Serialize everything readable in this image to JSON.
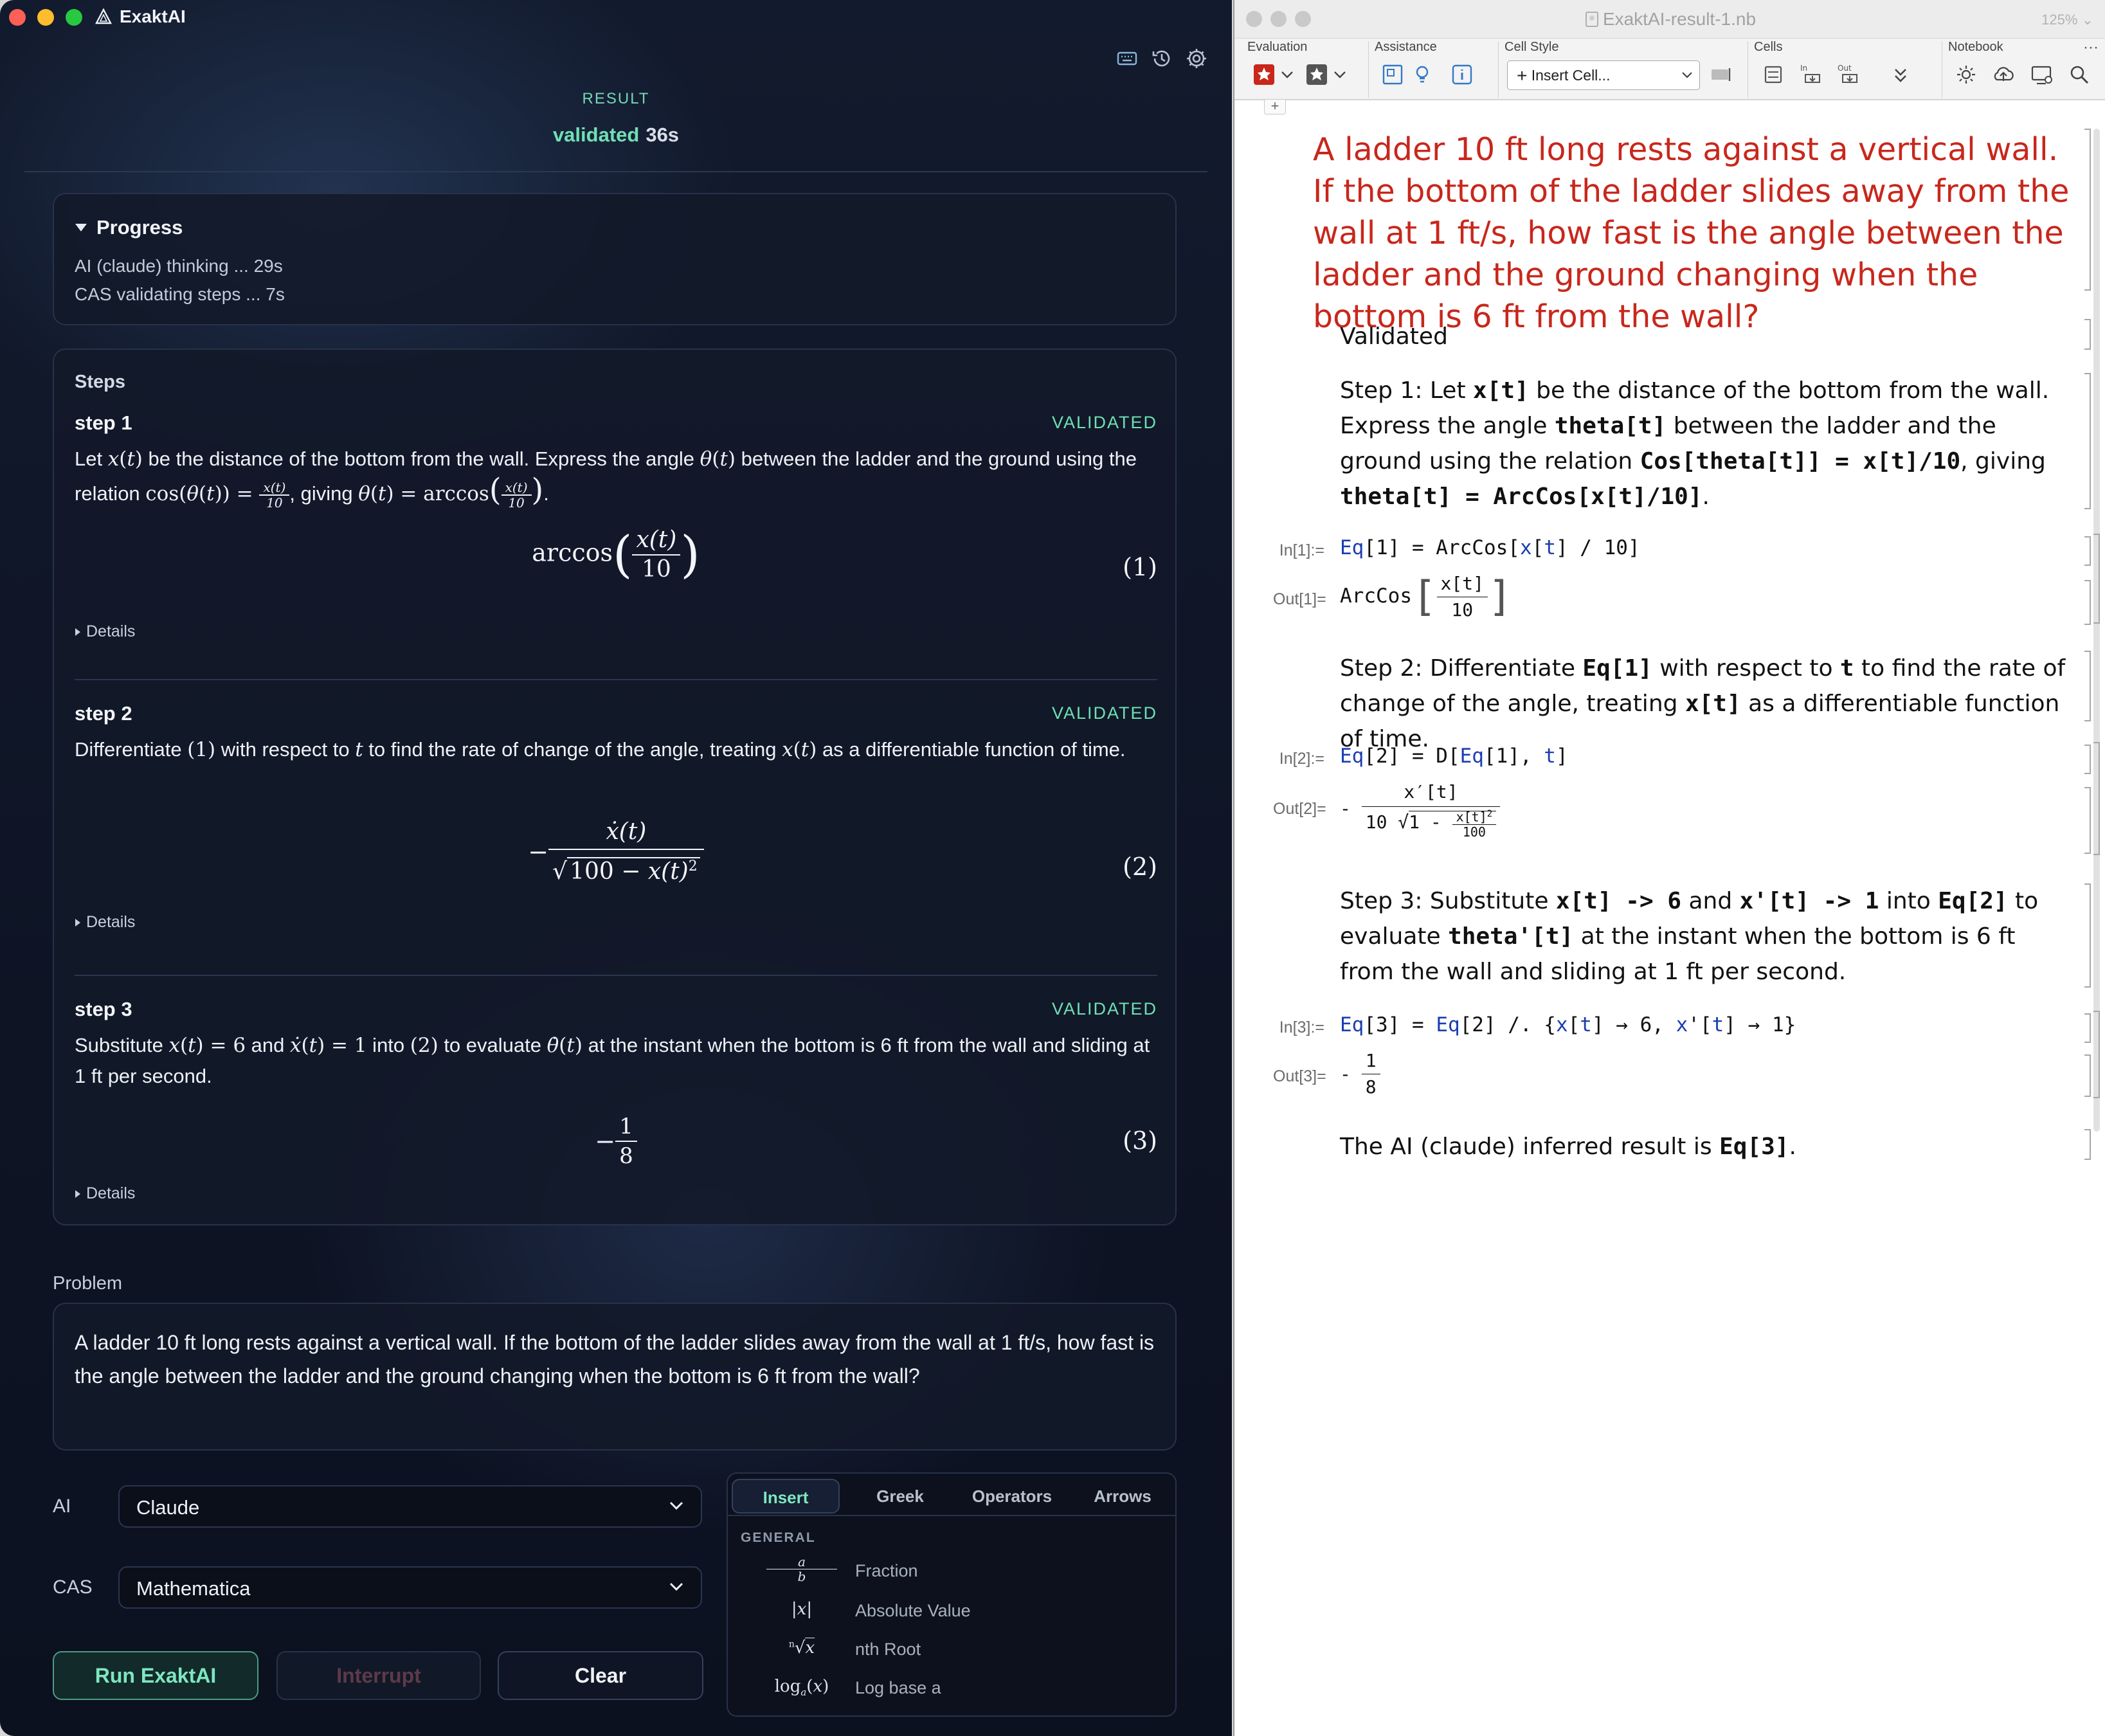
{
  "app": {
    "title": "ExaktAI",
    "result_label": "RESULT",
    "status": "validated",
    "time": "36s"
  },
  "progress": {
    "title": "Progress",
    "lines": [
      "AI (claude) thinking ... 29s",
      "CAS validating steps ... 7s"
    ]
  },
  "steps": {
    "title": "Steps",
    "details_label": "Details",
    "items": [
      {
        "name": "step 1",
        "badge": "VALIDATED",
        "eq_num": "(1)"
      },
      {
        "name": "step 2",
        "badge": "VALIDATED",
        "eq_num": "(2)"
      },
      {
        "name": "step 3",
        "badge": "VALIDATED",
        "eq_num": "(3)"
      }
    ]
  },
  "problem": {
    "label": "Problem",
    "text": "A ladder 10 ft long rests against a vertical wall. If the bottom of the ladder slides away from the wall at 1 ft/s, how fast is the angle between the ladder and the ground changing when the bottom is 6 ft from the wall?"
  },
  "controls": {
    "ai_label": "AI",
    "ai_value": "Claude",
    "cas_label": "CAS",
    "cas_value": "Mathematica",
    "run": "Run ExaktAI",
    "interrupt": "Interrupt",
    "clear": "Clear"
  },
  "palette": {
    "tabs": [
      "Insert",
      "Greek",
      "Operators",
      "Arrows"
    ],
    "section": "GENERAL",
    "items": [
      "Fraction",
      "Absolute Value",
      "nth Root",
      "Log base a"
    ]
  },
  "notebook": {
    "title": "ExaktAI-result-1.nb",
    "zoom": "125%",
    "toolbar_groups": [
      "Evaluation",
      "Assistance",
      "Cell Style",
      "Cells",
      "Notebook"
    ],
    "cell_style_value": "Insert Cell...",
    "problem": "A ladder 10 ft long rests against a vertical wall. If the bottom of the ladder slides away from the wall at 1 ft/s, how fast is the angle between the ladder and the ground changing when the bottom is 6 ft from the wall?",
    "validated": "Validated",
    "labels": [
      "In[1]:=",
      "Out[1]=",
      "In[2]:=",
      "Out[2]=",
      "In[3]:=",
      "Out[3]="
    ],
    "conclusion_prefix": "The AI (claude) inferred result is",
    "conclusion_ref": "Eq[3]"
  },
  "colors": {
    "accent": "#6fe0b4",
    "nb_title": "#c8271c",
    "nb_code_blue": "#1b3db0"
  }
}
